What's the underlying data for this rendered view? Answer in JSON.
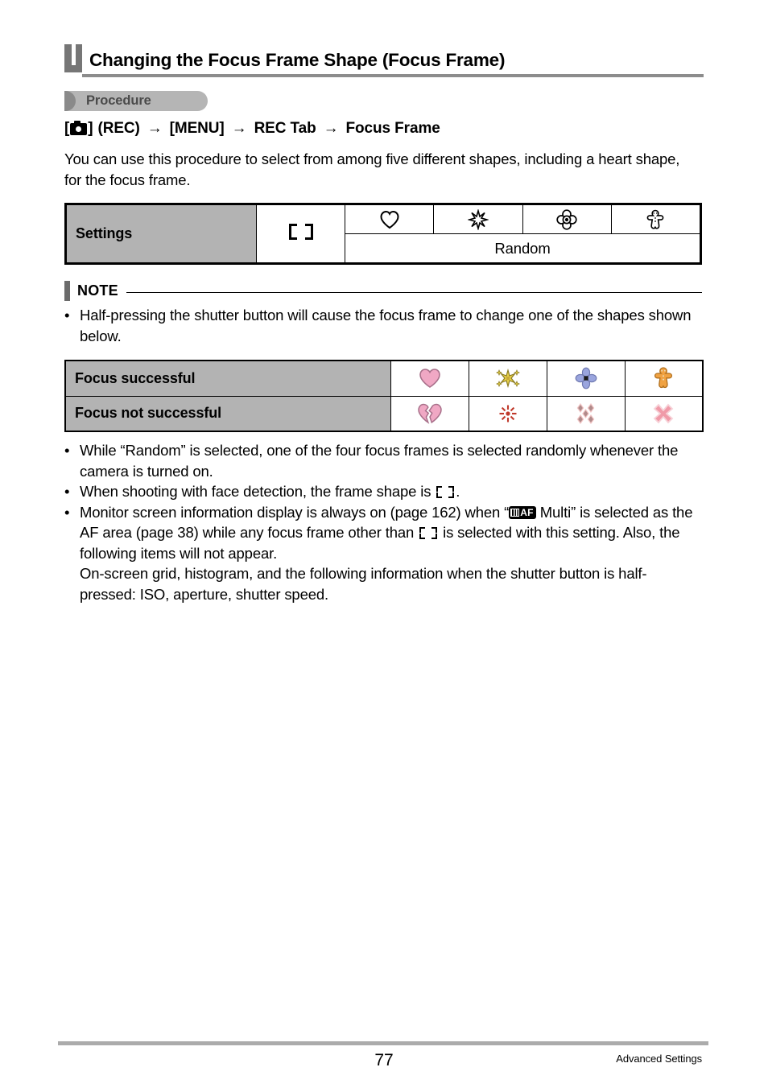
{
  "document": {
    "title": "Changing the Focus Frame Shape (Focus Frame)",
    "section_badge": "Procedure",
    "nav_path": {
      "camera_icon": "camera-icon",
      "bracket_open": "[",
      "bracket_close": "]",
      "rec_label": "(REC)",
      "arrow": "→",
      "menu_label": "[MENU]",
      "rec_tab_label": "REC Tab",
      "focus_frame_label": "Focus Frame"
    },
    "intro": "You can use this procedure to select from among five different shapes, including a heart shape, for the focus frame."
  },
  "settings_table": {
    "row_label": "Settings",
    "default_frame_icon": "focus-frame-brackets-icon",
    "shape_icons": [
      "heart-outline-icon",
      "sparkle-outline-icon",
      "flower-outline-icon",
      "gingerbread-outline-icon"
    ],
    "random_label": "Random"
  },
  "note": {
    "label": "NOTE",
    "bullets": [
      "Half-pressing the shutter button will cause the focus frame to change one of the shapes shown below."
    ]
  },
  "focus_table": {
    "rows": [
      {
        "label": "Focus successful",
        "icons": [
          "pink-heart-icon",
          "yellow-sparkle-icon",
          "blue-flower-icon",
          "orange-gingerbread-icon"
        ]
      },
      {
        "label": "Focus not successful",
        "icons": [
          "broken-heart-icon",
          "red-burst-icon",
          "scattered-diamonds-icon",
          "pink-x-icon"
        ]
      }
    ]
  },
  "bullets_after": [
    {
      "parts": [
        {
          "type": "text",
          "value": "While “Random” is selected, one of the four focus frames is selected randomly whenever the camera is turned on."
        }
      ]
    },
    {
      "parts": [
        {
          "type": "text",
          "value": "When shooting with face detection, the frame shape is "
        },
        {
          "type": "icon",
          "value": "focus-frame-brackets-icon"
        },
        {
          "type": "text",
          "value": "."
        }
      ]
    },
    {
      "parts": [
        {
          "type": "text",
          "value": "Monitor screen information display is always on (page 162) when “"
        },
        {
          "type": "icon",
          "value": "af-multi-badge-icon"
        },
        {
          "type": "text",
          "value": " Multi” is selected as the AF area (page 38) while any focus frame other than "
        },
        {
          "type": "icon",
          "value": "focus-frame-brackets-icon"
        },
        {
          "type": "text",
          "value": " is selected with this setting. Also, the following items will not appear."
        },
        {
          "type": "break",
          "value": ""
        },
        {
          "type": "text",
          "value": "On-screen grid, histogram, and the following information when the shutter button is half-pressed: ISO, aperture, shutter speed."
        }
      ]
    }
  ],
  "af_badge": {
    "text": "AF"
  },
  "footer": {
    "page_number": "77",
    "section_name": "Advanced Settings"
  },
  "colors": {
    "header_gray": "#b3b3b3",
    "title_bar_gray": "#767676",
    "badge_gray": "#b5b5b5",
    "badge_tab_gray": "#8a8a8a",
    "footer_rule": "#ababab",
    "pink_heart": "#f0a8c4",
    "yellow_sparkle": "#e8d24a",
    "blue_flower": "#9aa5de",
    "orange_gingerbread": "#f0a242",
    "red_burst": "#c0392b",
    "mauve_diamond": "#b08a8a",
    "pink_x": "#f09aa8"
  }
}
